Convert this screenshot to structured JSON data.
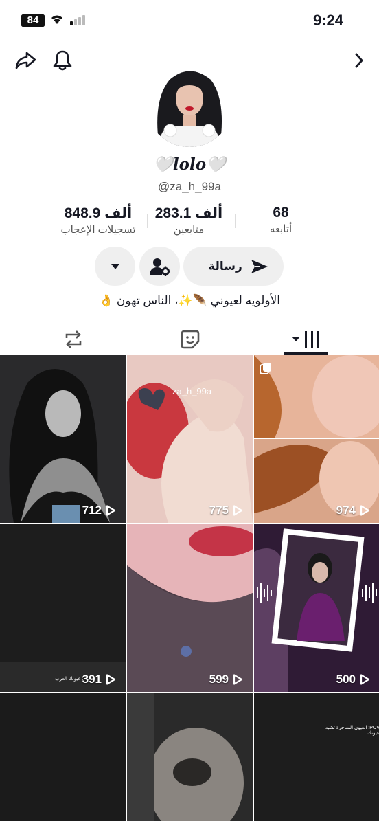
{
  "status_bar": {
    "battery": "84",
    "time": "9:24"
  },
  "profile": {
    "display_name": "🤍lolo🤍",
    "handle": "@za_h_99a",
    "bio": "الأولويه لعيوني 🪶✨، الناس تهون 👌"
  },
  "stats": [
    {
      "value": "848.9 ألف",
      "label": "تسجيلات الإعجاب"
    },
    {
      "value": "283.1 ألف",
      "label": "متابعين"
    },
    {
      "value": "68",
      "label": "أتابعه"
    }
  ],
  "buttons": {
    "message": "رسالة"
  },
  "icons": {
    "share": "share-icon",
    "bell": "bell-icon",
    "forward": "chevron-right-icon",
    "send": "send-icon",
    "person_settings": "person-settings-icon",
    "dropdown": "dropdown-triangle-icon",
    "repost": "repost-icon",
    "sticker": "sticker-icon",
    "grid": "grid-icon",
    "play": "play-icon"
  },
  "videos": [
    {
      "views": "712"
    },
    {
      "views": "775",
      "watermark": "za_h_99a"
    },
    {
      "views": "974"
    },
    {
      "views": "391",
      "caption": "POV: عيونك العرب"
    },
    {
      "views": "599"
    },
    {
      "views": "500"
    },
    {
      "caption": "POV: العيون الساحرة تشبه عيونك"
    },
    {},
    {}
  ]
}
